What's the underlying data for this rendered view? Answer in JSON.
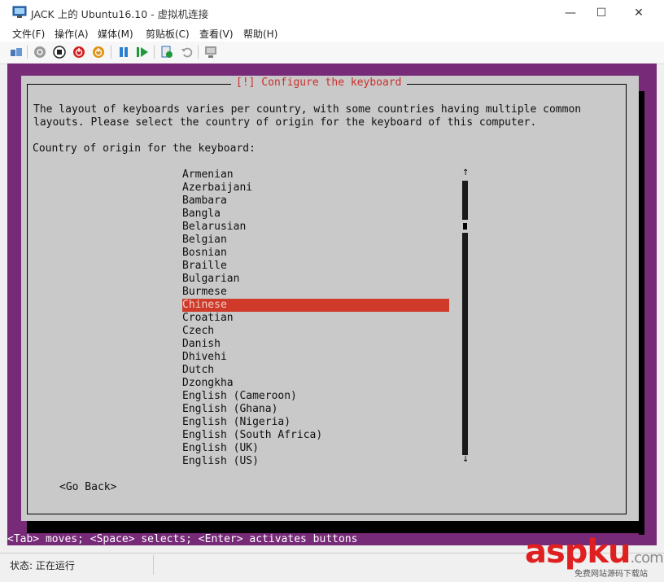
{
  "window": {
    "title": "JACK 上的 Ubuntu16.10 - 虚拟机连接",
    "minimize": "—",
    "maximize": "☐",
    "close": "✕"
  },
  "menu": [
    "文件(F)",
    "操作(A)",
    "媒体(M)",
    "剪贴板(C)",
    "查看(V)",
    "帮助(H)"
  ],
  "toolbar": {
    "icons": [
      "ctrl-alt-del-icon",
      "start-icon",
      "turn-off-icon",
      "shutdown-icon",
      "power-icon",
      "pause-icon",
      "resume-icon",
      "checkpoint-icon",
      "revert-icon",
      "enhanced-session-icon"
    ]
  },
  "installer": {
    "title": "[!] Configure the keyboard",
    "description_line1": "The layout of keyboards varies per country, with some countries having multiple common",
    "description_line2": "layouts. Please select the country of origin for the keyboard of this computer.",
    "prompt": "Country of origin for the keyboard:",
    "options": [
      "Armenian",
      "Azerbaijani",
      "Bambara",
      "Bangla",
      "Belarusian",
      "Belgian",
      "Bosnian",
      "Braille",
      "Bulgarian",
      "Burmese",
      "Chinese",
      "Croatian",
      "Czech",
      "Danish",
      "Dhivehi",
      "Dutch",
      "Dzongkha",
      "English (Cameroon)",
      "English (Ghana)",
      "English (Nigeria)",
      "English (South Africa)",
      "English (UK)",
      "English (US)"
    ],
    "selected": "Chinese",
    "scroll_up": "↑",
    "scroll_down": "↓",
    "go_back": "<Go Back>",
    "hint": "<Tab> moves; <Space> selects; <Enter> activates buttons"
  },
  "status": {
    "text": "状态: 正在运行"
  },
  "watermark": {
    "logo": "aspku",
    "suffix": ".com",
    "caption": "免费网站源码下载站"
  },
  "colors": {
    "accent": "#d03a2b",
    "vm_background": "#772a78",
    "dialog": "#c9c9c9"
  }
}
